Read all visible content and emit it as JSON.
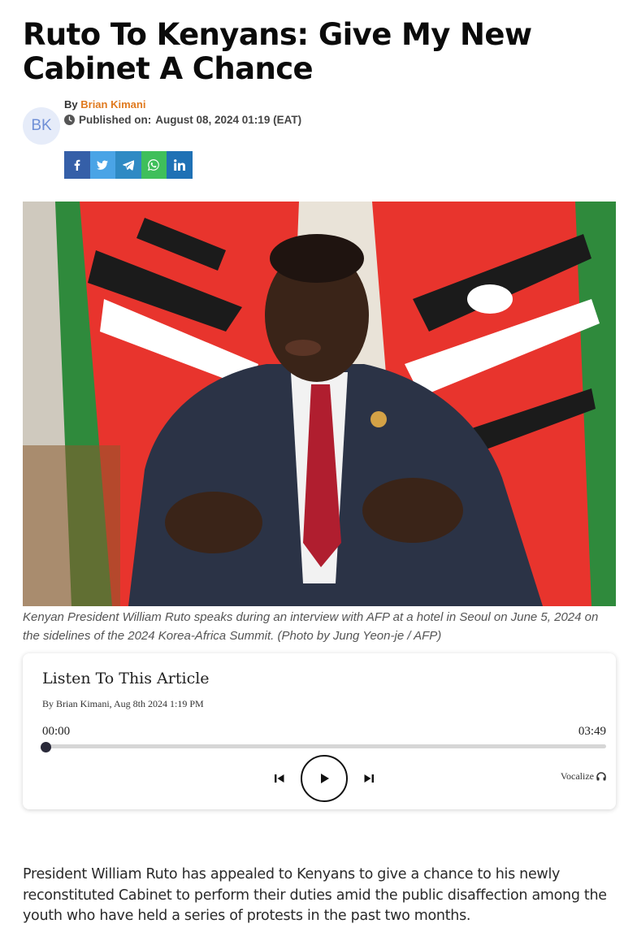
{
  "article": {
    "headline": "Ruto To Kenyans: Give My New Cabinet A Chance",
    "author_initials": "BK",
    "by_prefix": "By",
    "author_name": "Brian Kimani",
    "published_label": "Published on:",
    "published_date": "August 08, 2024 01:19 (EAT)",
    "image_caption": "Kenyan President William Ruto speaks during an interview with AFP at a hotel in Seoul on June 5, 2024 on the sidelines of the 2024 Korea-Africa Summit. (Photo by Jung Yeon-je / AFP)",
    "body_paragraph": "President William Ruto has appealed to Kenyans to give a chance to his newly reconstituted Cabinet to perform their duties amid the public disaffection among the youth who have held a series of protests in the past two months."
  },
  "share": {
    "icons": [
      "facebook-icon",
      "twitter-icon",
      "telegram-icon",
      "whatsapp-icon",
      "linkedin-icon"
    ],
    "colors": {
      "facebook": "#355fa8",
      "twitter": "#4aa4e6",
      "telegram": "#2f8ac4",
      "whatsapp": "#3fbf5b",
      "linkedin": "#1f71b5"
    }
  },
  "player": {
    "title": "Listen To This Article",
    "meta": "By Brian Kimani, Aug 8th 2024 1:19 PM",
    "current_time": "00:00",
    "duration": "03:49",
    "progress": 0,
    "brand": "Vocalize",
    "brand_icon": "headphones-icon"
  },
  "colors": {
    "accent": "#e07a1f",
    "avatar_bg": "#e6ecf9",
    "avatar_text": "#6f8fd6"
  }
}
